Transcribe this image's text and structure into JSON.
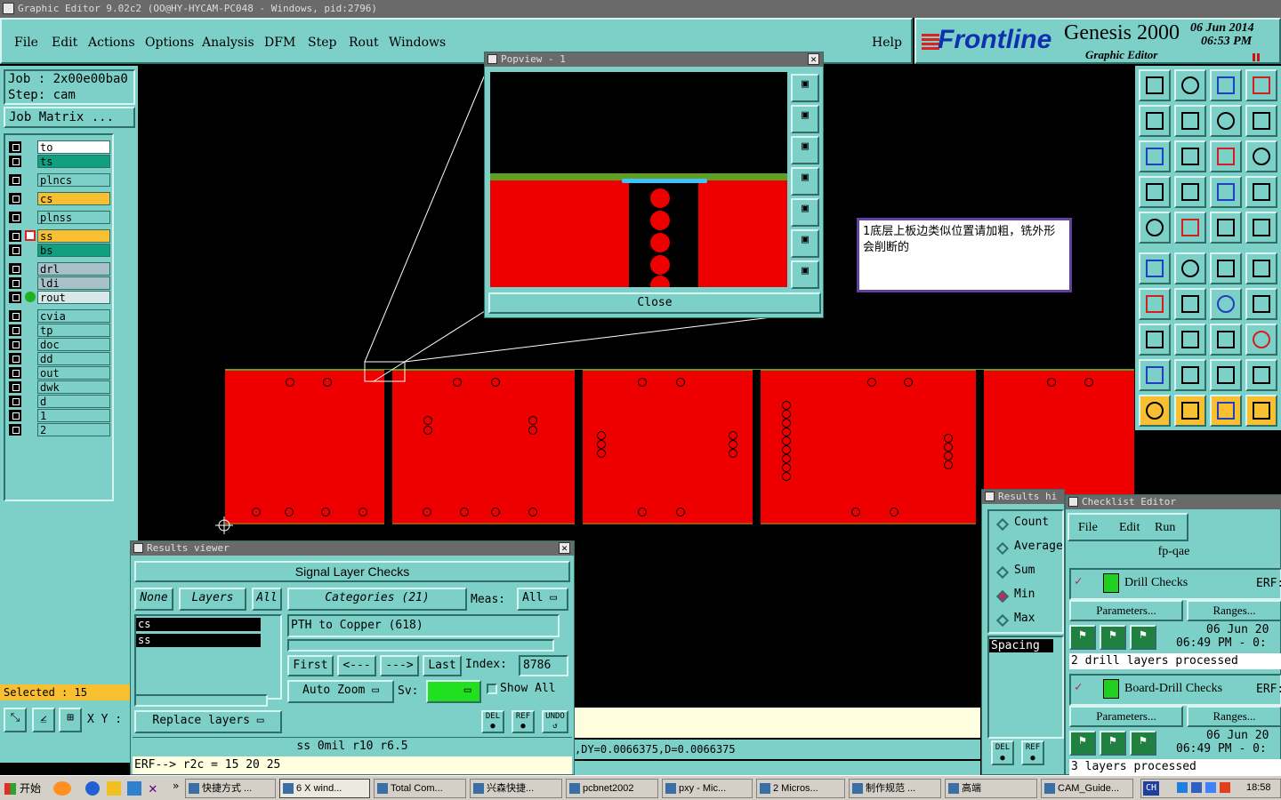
{
  "window_title": "Graphic Editor 9.02c2  (OO@HY-HYCAM-PC048 - Windows, pid:2796)",
  "menu": [
    "File",
    "Edit",
    "Actions",
    "Options",
    "Analysis",
    "DFM",
    "Step",
    "Rout",
    "Windows"
  ],
  "help": "Help",
  "brand": {
    "logo": "Frontline",
    "product": "Genesis 2000",
    "subtitle": "Graphic Editor",
    "date": "06 Jun 2014",
    "time": "06:53 PM"
  },
  "job": {
    "job": "Job : 2x00e00ba0",
    "step": "Step: cam",
    "matrix_button": "Job Matrix ..."
  },
  "layers": [
    {
      "name": "to",
      "color": "#ffffff"
    },
    {
      "name": "ts",
      "color": "#10a080"
    },
    {
      "name": "plncs",
      "color": "#7dd0c8"
    },
    {
      "name": "cs",
      "color": "#f8c030"
    },
    {
      "name": "plnss",
      "color": "#7dd0c8"
    },
    {
      "name": "ss",
      "color": "#f8c030"
    },
    {
      "name": "bs",
      "color": "#10a080"
    },
    {
      "name": "drl",
      "color": "#a8c0c8"
    },
    {
      "name": "ldi",
      "color": "#a8c0c8"
    },
    {
      "name": "rout",
      "color": "#d8e8e8"
    },
    {
      "name": "cvia",
      "color": "#7dd0c8"
    },
    {
      "name": "tp",
      "color": "#7dd0c8"
    },
    {
      "name": "doc",
      "color": "#7dd0c8"
    },
    {
      "name": "dd",
      "color": "#7dd0c8"
    },
    {
      "name": "out",
      "color": "#7dd0c8"
    },
    {
      "name": "dwk",
      "color": "#7dd0c8"
    },
    {
      "name": "d",
      "color": "#7dd0c8"
    },
    {
      "name": "1",
      "color": "#7dd0c8"
    },
    {
      "name": "2",
      "color": "#7dd0c8"
    }
  ],
  "selected": "Selected : 15",
  "xy_label": "X Y :",
  "popview": {
    "title": "Popview - 1",
    "close": "Close"
  },
  "note": "1底层上板边类似位置请加粗，铣外形会削断的",
  "results_viewer": {
    "title": "Results viewer",
    "header": "Signal Layer Checks",
    "none": "None",
    "layers": "Layers",
    "all": "All",
    "layer_list": [
      "cs",
      "ss"
    ],
    "categories": "Categories (21)",
    "meas_label": "Meas:",
    "meas_value": "All",
    "category_item": "PTH to Copper (618)",
    "nav": [
      "First",
      "<---",
      "--->",
      "Last"
    ],
    "index_label": "Index:",
    "index_value": "8786",
    "auto_zoom": "Auto Zoom",
    "sv_label": "Sv:",
    "show_all": "Show All",
    "replace_layers": "Replace layers",
    "del": "DEL",
    "ref": "REF",
    "undo": "UNDO",
    "status1": "ss 0mil  r10  r6.5",
    "status2": "ERF--> r2c = 15 20 25"
  },
  "coord_status": ",DY=0.0066375,D=0.0066375",
  "results_hist": {
    "title": "Results hi",
    "options": [
      "Count",
      "Average",
      "Sum",
      "Min",
      "Max"
    ],
    "selected": "Min",
    "list_item": "Spacing",
    "del": "DEL",
    "ref": "REF"
  },
  "checklist": {
    "title": "Checklist Editor",
    "menu": [
      "File",
      "Edit",
      "Run"
    ],
    "name": "fp-qae",
    "checks": [
      {
        "name": "Drill Checks",
        "erf": "ERF:",
        "params": "Parameters...",
        "ranges": "Ranges...",
        "date": "06 Jun 20",
        "time": "06:49 PM - 0:",
        "status": "2 drill layers processed"
      },
      {
        "name": "Board-Drill Checks",
        "erf": "ERF:",
        "params": "Parameters...",
        "ranges": "Ranges...",
        "date": "06 Jun 20",
        "time": "06:49 PM - 0:",
        "status": "3 layers processed"
      }
    ]
  },
  "taskbar": {
    "start": "开始",
    "items": [
      "快捷方式 ...",
      "6 X wind...",
      "Total Com...",
      "兴森快捷...",
      "pcbnet2002",
      "pxy - Mic...",
      "2 Micros...",
      "制作规范 ...",
      "高端",
      "CAM_Guide..."
    ],
    "lang": "CH",
    "clock": "18:58"
  }
}
